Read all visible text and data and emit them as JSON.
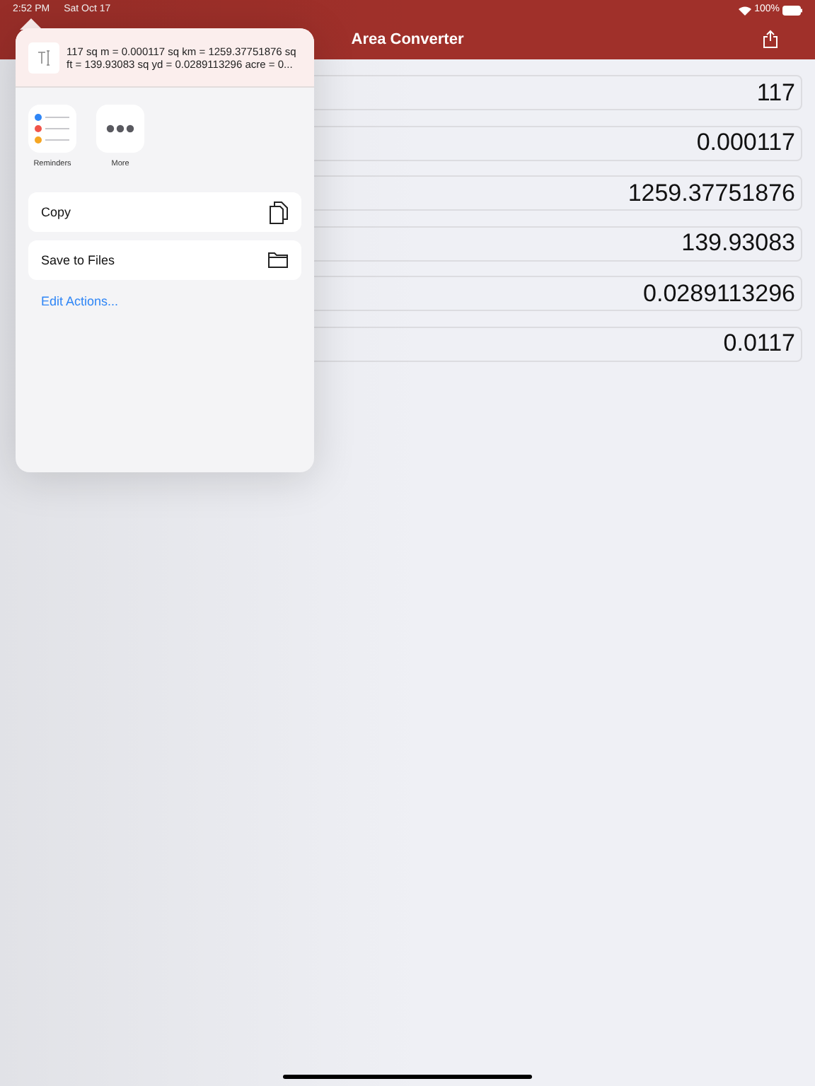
{
  "status_bar": {
    "time": "2:52 PM",
    "date": "Sat Oct 17",
    "battery": "100%"
  },
  "nav": {
    "title": "Area Converter"
  },
  "rows": [
    {
      "value": "117"
    },
    {
      "value": "0.000117"
    },
    {
      "value": "1259.37751876"
    },
    {
      "value": "139.93083"
    },
    {
      "value": "0.0289113296"
    },
    {
      "value": "0.0117"
    }
  ],
  "share_sheet": {
    "preview": "117 sq m = 0.000117 sq km = 1259.37751876 sq ft = 139.93083 sq yd = 0.0289113296 acre = 0...",
    "apps": [
      {
        "kind": "reminders",
        "label": "Reminders"
      },
      {
        "kind": "more",
        "label": "More"
      }
    ],
    "actions": [
      {
        "kind": "copy",
        "label": "Copy"
      },
      {
        "kind": "files",
        "label": "Save to Files"
      }
    ],
    "edit_link": "Edit Actions..."
  }
}
